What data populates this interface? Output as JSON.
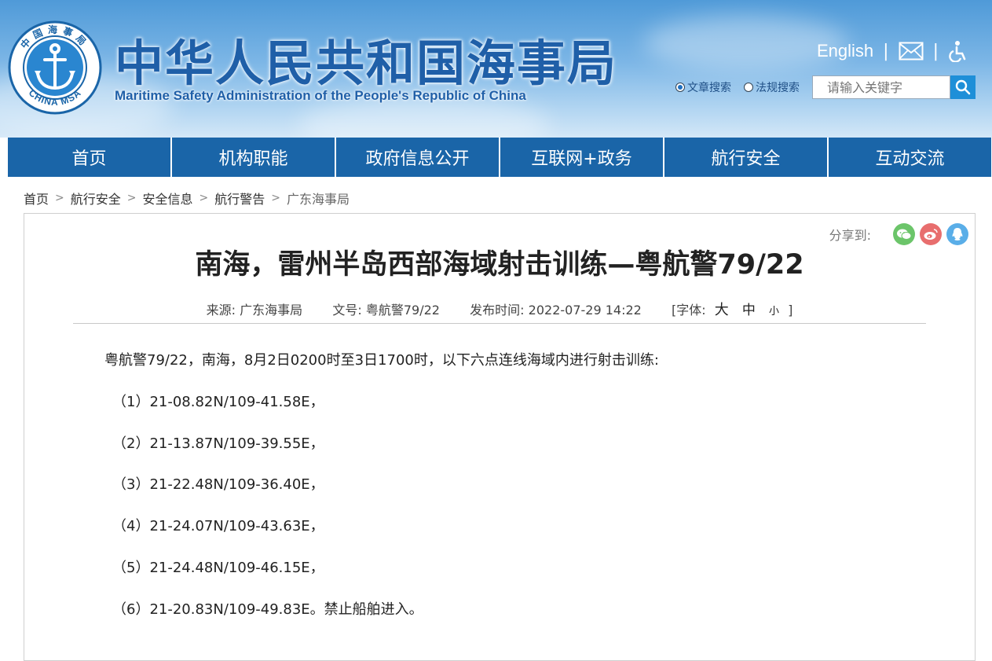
{
  "header": {
    "logo_top_text": "中国海事局",
    "logo_bottom_text": "CHINA MSA",
    "title_cn": "中华人民共和国海事局",
    "title_en": "Maritime Safety Administration of the People's Republic of China",
    "english_link": "English",
    "search": {
      "option_article": "文章搜索",
      "option_law": "法规搜索",
      "selected": "文章搜索",
      "placeholder": "请输入关键字"
    }
  },
  "nav": {
    "items": [
      "首页",
      "机构职能",
      "政府信息公开",
      "互联网+政务",
      "航行安全",
      "互动交流"
    ]
  },
  "breadcrumb": [
    "首页",
    "航行安全",
    "安全信息",
    "航行警告",
    "广东海事局"
  ],
  "article": {
    "share_label": "分享到:",
    "title": "南海，雷州半岛西部海域射击训练—粤航警79/22",
    "meta": {
      "source_label": "来源:",
      "source": "广东海事局",
      "doc_label": "文号:",
      "doc_no": "粤航警79/22",
      "time_label": "发布时间:",
      "time": "2022-07-29 14:22",
      "font_label": "[字体:",
      "font_large": "大",
      "font_medium": "中",
      "font_small": "小",
      "font_close": "]"
    },
    "intro": "粤航警79/22，南海，8月2日0200时至3日1700时，以下六点连线海域内进行射击训练:",
    "points": [
      "（1）21-08.82N/109-41.58E，",
      "（2）21-13.87N/109-39.55E，",
      "（3）21-22.48N/109-36.40E，",
      "（4）21-24.07N/109-43.63E，",
      "（5）21-24.48N/109-46.15E，",
      "（6）21-20.83N/109-49.83E。禁止船舶进入。"
    ]
  },
  "colors": {
    "nav_bg": "#1a65a8",
    "title_blue": "#1f5fa8",
    "search_btn": "#1e8fd8",
    "wechat": "#6cc56a",
    "weibo": "#e86e6e",
    "qq": "#5aaee8"
  }
}
